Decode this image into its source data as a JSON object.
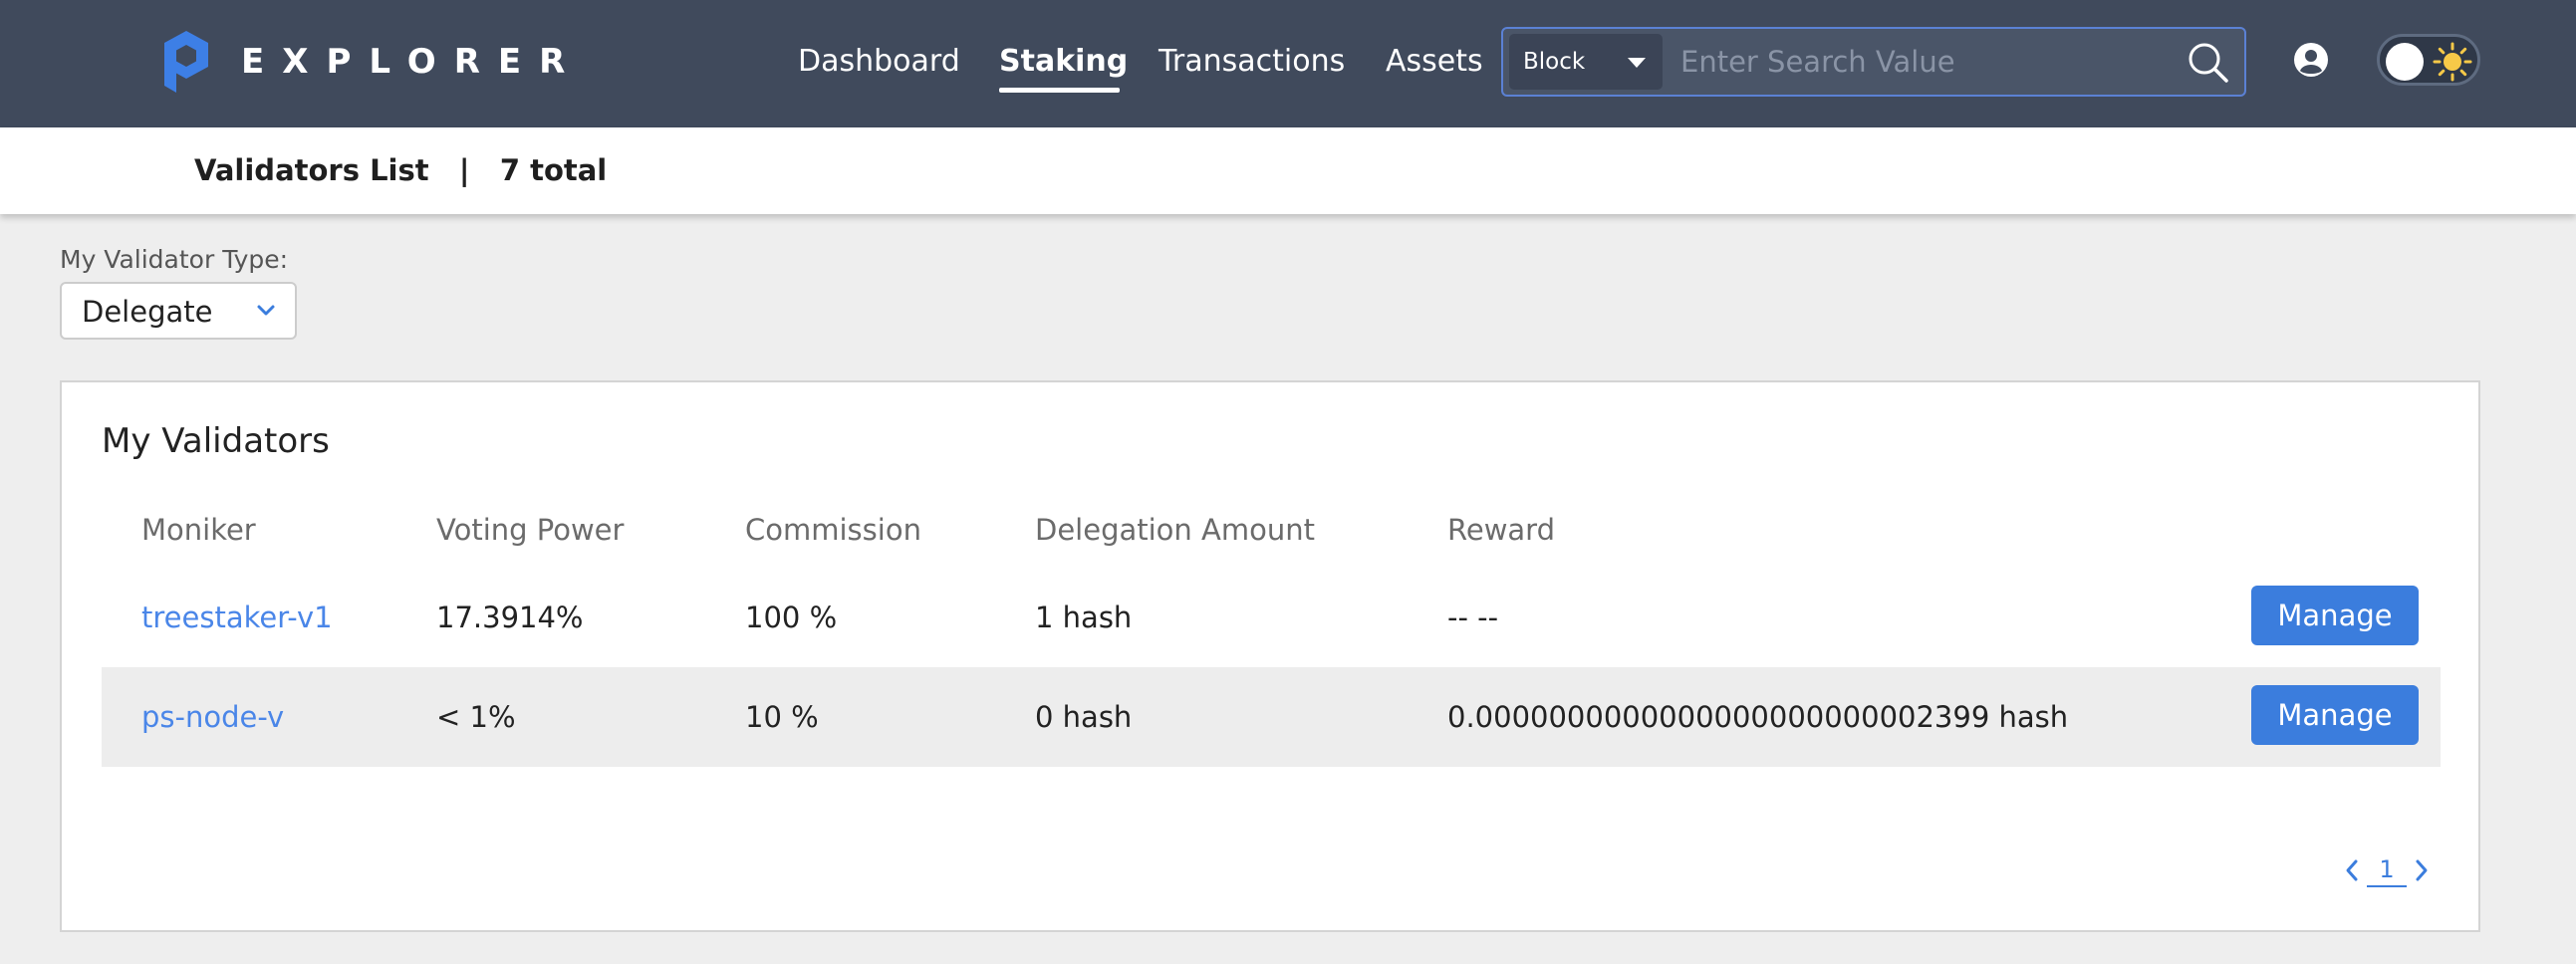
{
  "header": {
    "brand": "EXPLORER",
    "nav": [
      {
        "label": "Dashboard",
        "active": false
      },
      {
        "label": "Staking",
        "active": true
      },
      {
        "label": "Transactions",
        "active": false
      },
      {
        "label": "Assets",
        "active": false
      }
    ],
    "search": {
      "type_selected": "Block",
      "placeholder": "Enter Search Value"
    },
    "icons": {
      "logo": "logo-p-icon",
      "search": "search-icon",
      "user": "user-circle-icon",
      "theme": "sun-icon"
    },
    "colors": {
      "bar": "#404a5c",
      "accent": "#3b7ddd"
    }
  },
  "subheader": {
    "title": "Validators List",
    "separator": "|",
    "total": "7 total"
  },
  "filter": {
    "label": "My Validator Type:",
    "selected": "Delegate"
  },
  "card": {
    "title": "My Validators",
    "columns": [
      "Moniker",
      "Voting Power",
      "Commission",
      "Delegation Amount",
      "Reward"
    ],
    "rows": [
      {
        "moniker": "treestaker-v1",
        "voting_power": "17.3914%",
        "commission": "100 %",
        "delegation_amount": "1 hash",
        "reward": "-- --",
        "action": "Manage"
      },
      {
        "moniker": "ps-node-v",
        "voting_power": "< 1%",
        "commission": "10 %",
        "delegation_amount": "0 hash",
        "reward": "0.0000000000000000000000002399 hash",
        "action": "Manage"
      }
    ]
  },
  "pagination": {
    "current_page": "1"
  }
}
